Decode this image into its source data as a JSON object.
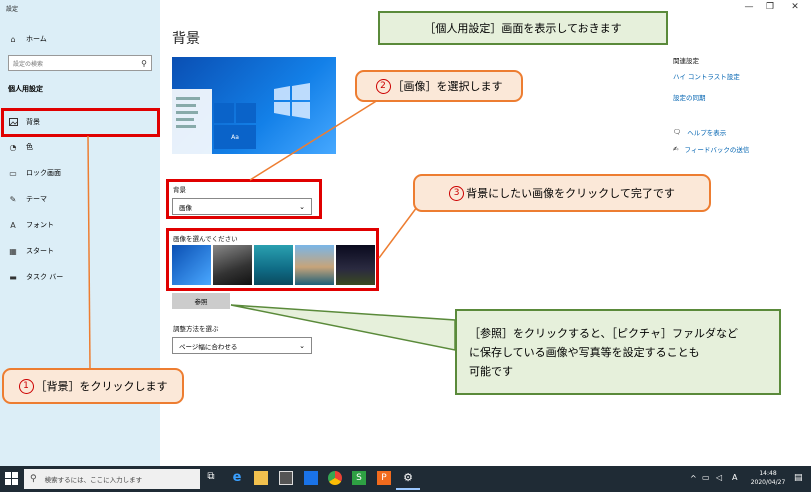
{
  "window": {
    "app_title": "設定",
    "minimize": "—",
    "maximize": "❐",
    "close": "✕"
  },
  "sidebar": {
    "home_label": "ホーム",
    "search_placeholder": "設定の検索",
    "section_title": "個人用設定",
    "items": [
      {
        "label": "背景",
        "icon": "image-icon"
      },
      {
        "label": "色",
        "icon": "palette-icon"
      },
      {
        "label": "ロック画面",
        "icon": "lock-screen-icon"
      },
      {
        "label": "テーマ",
        "icon": "theme-icon"
      },
      {
        "label": "フォント",
        "icon": "font-icon"
      },
      {
        "label": "スタート",
        "icon": "start-icon"
      },
      {
        "label": "タスク バー",
        "icon": "taskbar-icon"
      }
    ]
  },
  "main": {
    "title": "背景",
    "preview_tile_label": "Aa",
    "background_label": "背景",
    "background_value": "画像",
    "choose_image_label": "画像を選んでください",
    "browse_label": "参照",
    "fit_label": "調整方法を選ぶ",
    "fit_value": "ページ幅に合わせる"
  },
  "right_panel": {
    "related_title": "関連設定",
    "links": [
      "ハイ コントラスト設定",
      "設定の同期"
    ],
    "help_label": "ヘルプを表示",
    "feedback_label": "フィードバックの送信"
  },
  "callouts": {
    "top": "［個人用設定］画面を表示しておきます",
    "step2_num": "2",
    "step2_text": "［画像］を選択します",
    "step3_num": "3",
    "step3_text": "背景にしたい画像をクリックして完了です",
    "browse_note_line1": "［参照］をクリックすると、［ピクチャ］ファルダなど",
    "browse_note_line2": "に保存している画像や写真等を設定することも",
    "browse_note_line3": "可能です",
    "step1_num": "1",
    "step1_text": "［背景］をクリックします"
  },
  "taskbar": {
    "search_placeholder": "検索するには、ここに入力します",
    "ime_label": "A",
    "time": "14:48",
    "date": "2020/04/27"
  },
  "colors": {
    "accent_red": "#e00000",
    "callout_green": "#5a8a3a",
    "callout_orange": "#ed7d31",
    "link_blue": "#0063b1"
  }
}
